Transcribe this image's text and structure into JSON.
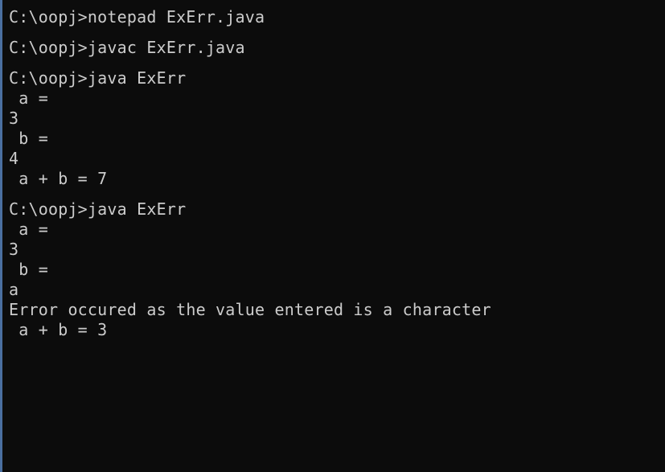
{
  "console": {
    "lines": [
      "C:\\oopj>notepad ExErr.java",
      "",
      "C:\\oopj>javac ExErr.java",
      "",
      "C:\\oopj>java ExErr",
      " a =",
      "3",
      " b =",
      "4",
      " a + b = 7",
      "",
      "C:\\oopj>java ExErr",
      " a =",
      "3",
      " b =",
      "a",
      "Error occured as the value entered is a character",
      " a + b = 3"
    ]
  }
}
